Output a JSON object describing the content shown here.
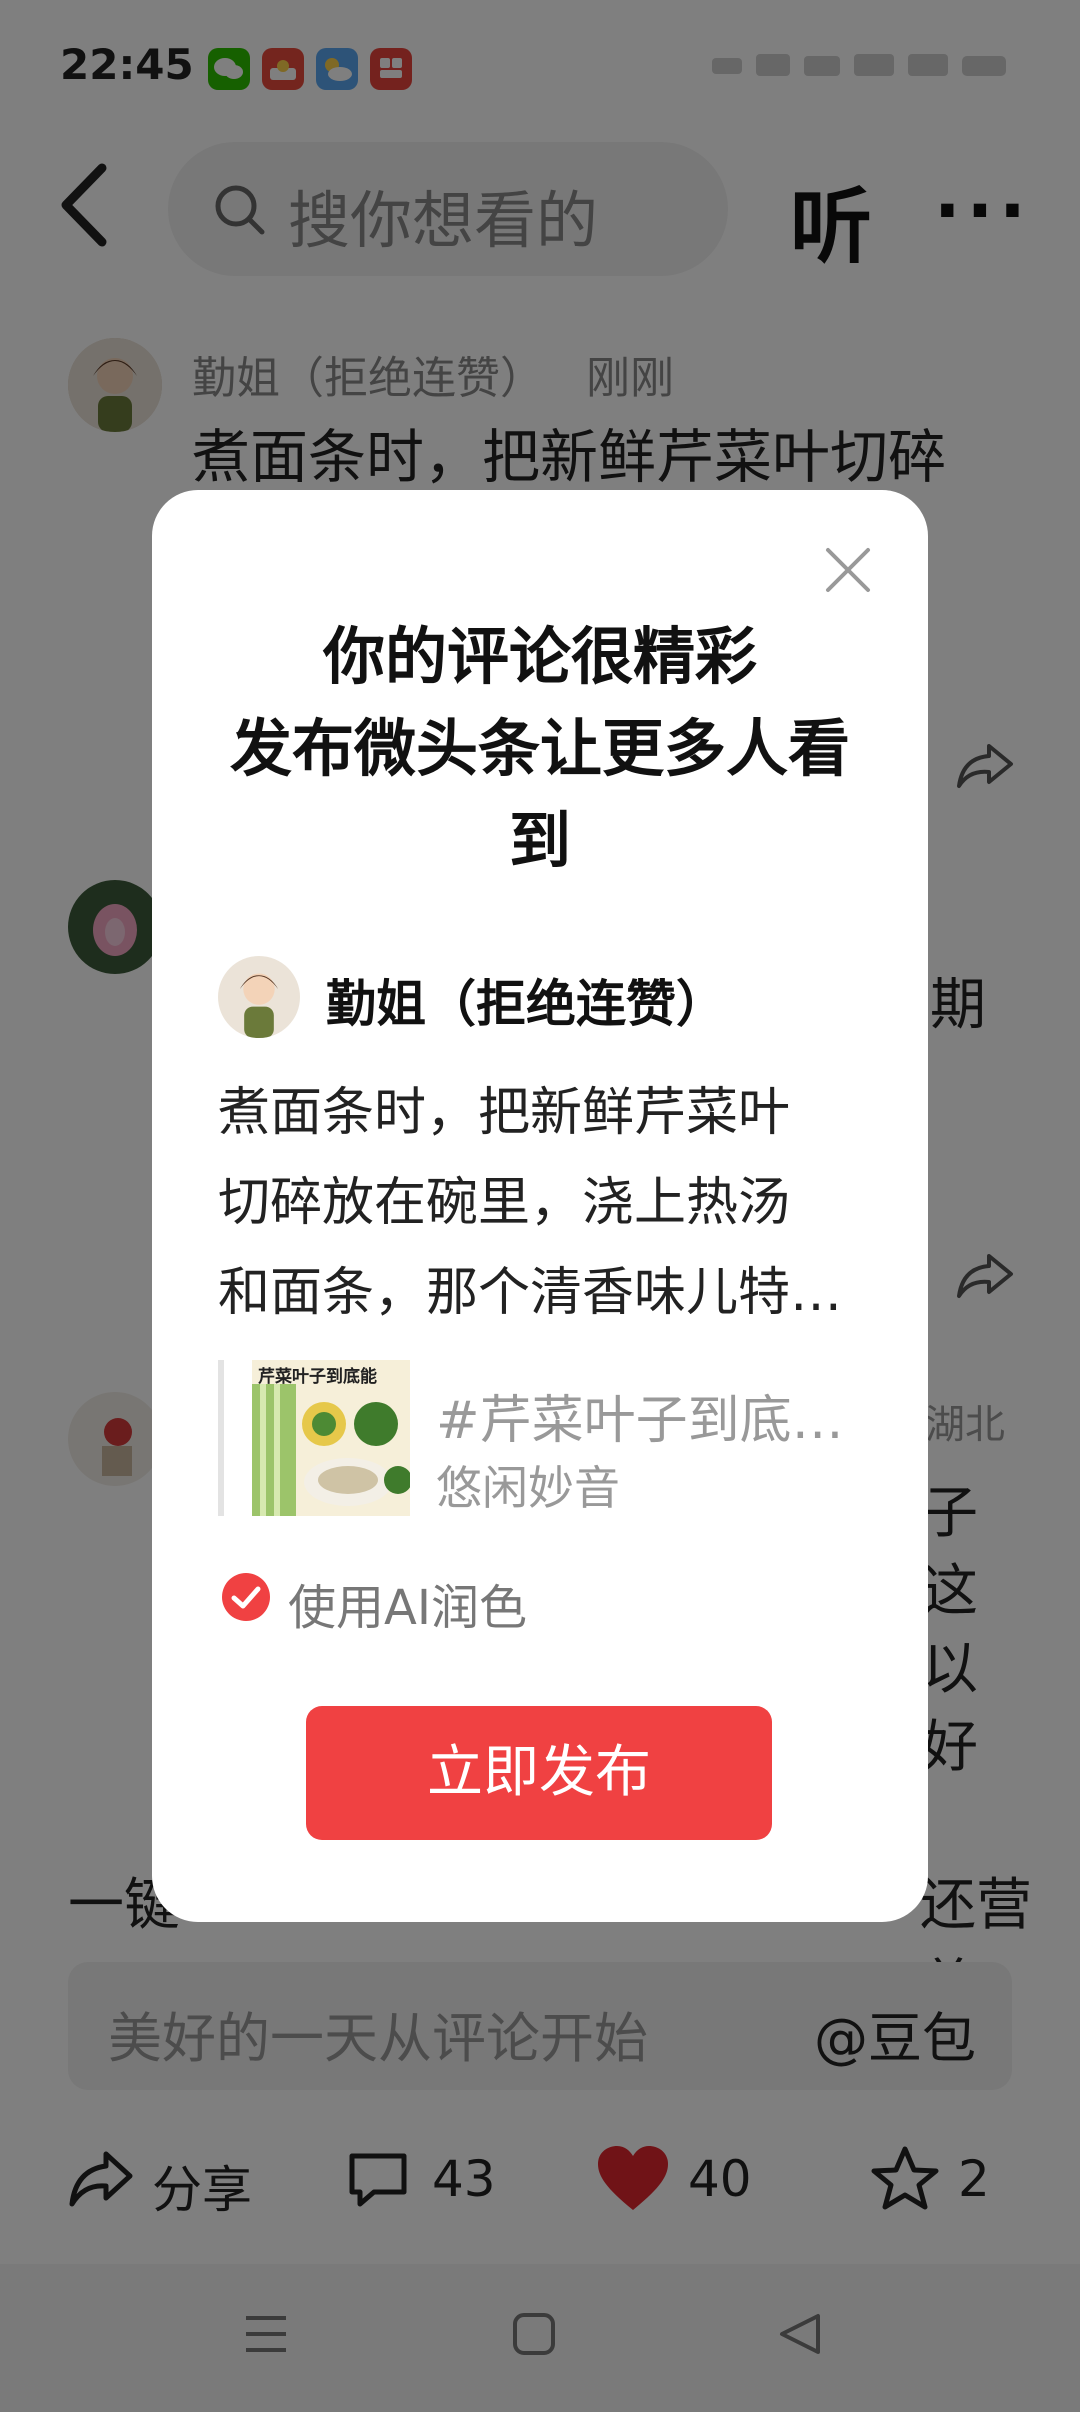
{
  "status_bar": {
    "time": "22:45",
    "apps": [
      {
        "icon": "wechat-icon",
        "color": "#2dc100"
      },
      {
        "icon": "toutiao-news-icon",
        "color": "#e94b3c"
      },
      {
        "icon": "weather-icon",
        "color": "#5aa6f0"
      },
      {
        "icon": "app-red-icon",
        "color": "#e8453c"
      }
    ]
  },
  "header": {
    "search_placeholder": "搜你想看的",
    "listen_label": "听",
    "more_label": "···"
  },
  "post": {
    "author": "勤姐（拒绝连赞）",
    "time": "刚刚",
    "text": "煮面条时，把新鲜芹菜叶切碎",
    "right_fragment_1": "期",
    "right_fragment_2": "湖北",
    "right_column": [
      "子",
      "这",
      "以",
      "好"
    ],
    "bottom_left": "一键",
    "bottom_right": "还营养"
  },
  "comment_input": {
    "placeholder": "美好的一天从评论开始",
    "mention": "@豆包"
  },
  "actions": {
    "share": "分享",
    "comments": "43",
    "likes": "40",
    "favorites": "2"
  },
  "dialog": {
    "title_line1": "你的评论很精彩",
    "title_line2": "发布微头条让更多人看",
    "title_line3": "到",
    "author": "勤姐（拒绝连赞）",
    "content_lines": [
      "煮面条时，把新鲜芹菜叶",
      "切碎放在碗里，浇上热汤",
      "和面条，那个清香味儿特…"
    ],
    "topic_title": "#芹菜叶子到底…",
    "topic_author": "悠闲妙音",
    "topic_thumb_text": "芹菜叶子到底能",
    "ai_polish_label": "使用AI润色",
    "publish_label": "立即发布"
  },
  "colors": {
    "accent": "#f04142",
    "like": "#e0262e"
  }
}
